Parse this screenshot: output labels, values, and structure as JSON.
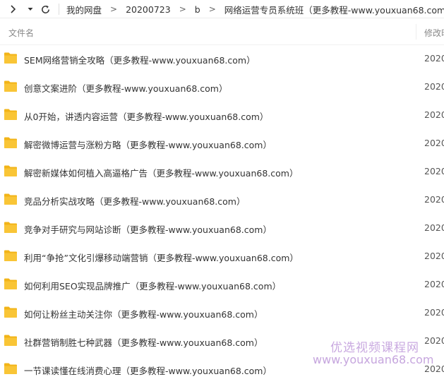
{
  "toolbar": {
    "icons": [
      "chevron-right-icon",
      "chevron-down-icon",
      "refresh-icon"
    ]
  },
  "breadcrumb": {
    "separator": ">",
    "items": [
      "我的网盘",
      "20200723",
      "b",
      "网络运营专员系统班（更多教程-www.youxuan68.com）"
    ]
  },
  "header": {
    "name_col": "文件名",
    "modified_col": "修改时间"
  },
  "files": [
    {
      "name": "SEM网络营销全攻略（更多教程-www.youxuan68.com）",
      "date": "2020"
    },
    {
      "name": "创意文案进阶（更多教程-www.youxuan68.com）",
      "date": "2020"
    },
    {
      "name": "从0开始，讲透内容运营（更多教程-www.youxuan68.com）",
      "date": "2020"
    },
    {
      "name": "解密微博运营与涨粉方略（更多教程-www.youxuan68.com）",
      "date": "2020"
    },
    {
      "name": "解密新媒体如何植入高逼格广告（更多教程-www.youxuan68.com）",
      "date": "2020"
    },
    {
      "name": "竞品分析实战攻略（更多教程-www.youxuan68.com）",
      "date": "2020"
    },
    {
      "name": "竞争对手研究与网站诊断（更多教程-www.youxuan68.com）",
      "date": "2020"
    },
    {
      "name": "利用“争抢”文化引爆移动端营销（更多教程-www.youxuan68.com）",
      "date": "2020"
    },
    {
      "name": "如何利用SEO实现品牌推广（更多教程-www.youxuan68.com）",
      "date": "2020"
    },
    {
      "name": "如何让粉丝主动关注你（更多教程-www.youxuan68.com）",
      "date": "2020"
    },
    {
      "name": "社群营销制胜七种武器（更多教程-www.youxuan68.com）",
      "date": "2020"
    },
    {
      "name": "一节课读懂在线消费心理（更多教程-www.youxuan68.com）",
      "date": "2020"
    }
  ],
  "watermark": {
    "line1": "优选视频课程网",
    "line2": "www.youxuan68.com"
  },
  "colors": {
    "folder": "#f9c536",
    "folder_tab": "#f2b418",
    "watermark": "#c9a9e0"
  }
}
